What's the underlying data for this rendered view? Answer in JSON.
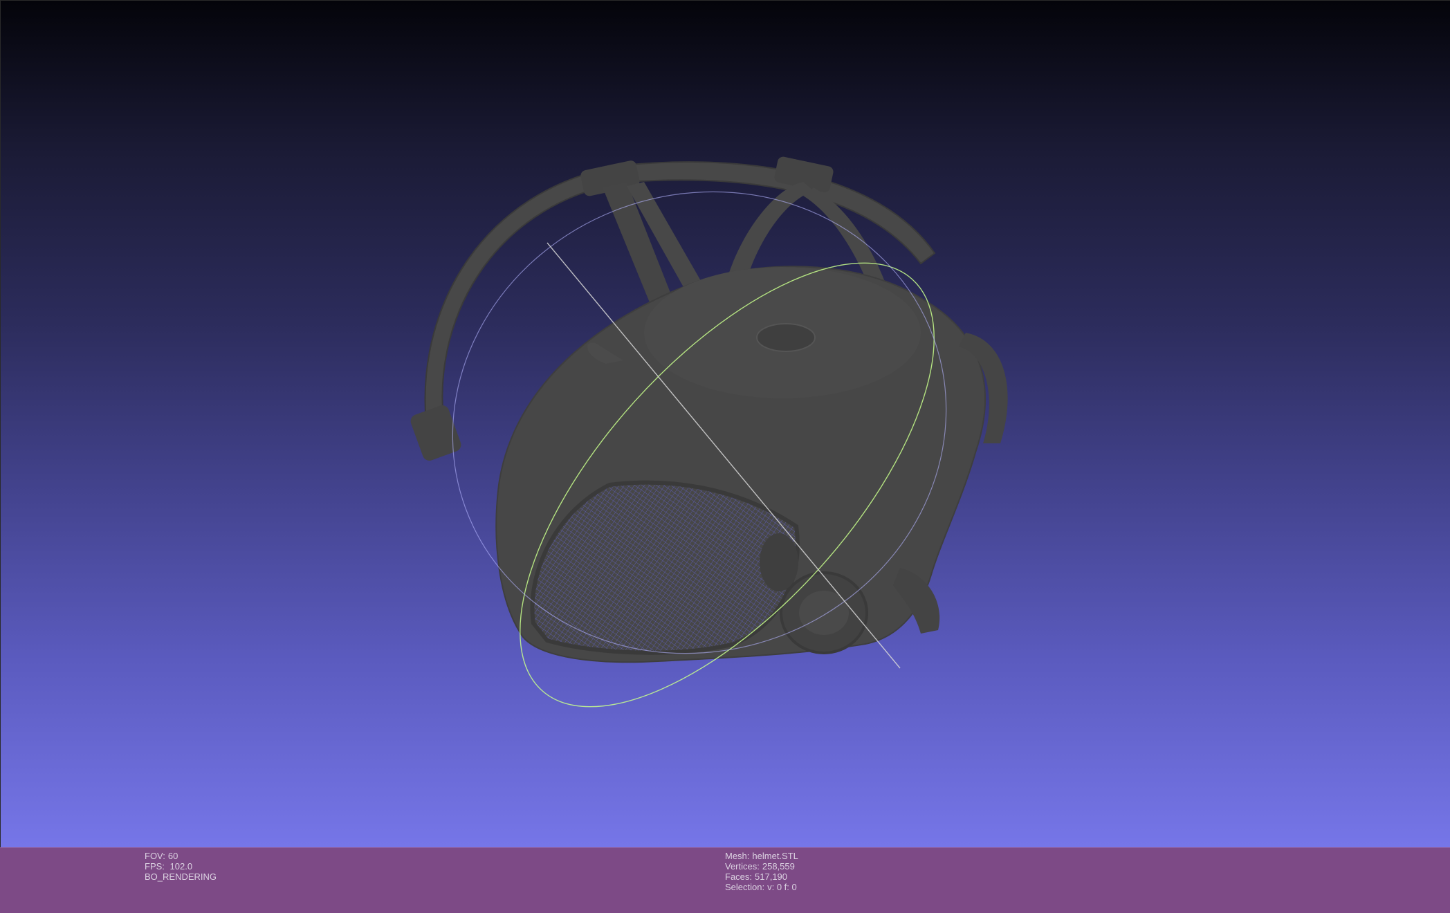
{
  "viewport": {
    "background_top": "#04040a",
    "background_bottom": "#7676e8",
    "mesh_color": "#454545",
    "trackball_colors": [
      "#c8c8c8",
      "#c8ff8c",
      "#b4b4ff"
    ]
  },
  "info_bar": {
    "background": "#7d4a86",
    "left": {
      "fov_label": "FOV:",
      "fov_value": "60",
      "fps_label": "FPS:",
      "fps_value": "102.0",
      "render_mode": "BO_RENDERING"
    },
    "right": {
      "mesh_label": "Mesh:",
      "mesh_value": "helmet.STL",
      "vertices_label": "Vertices:",
      "vertices_value": "258,559",
      "faces_label": "Faces:",
      "faces_value": "517,190",
      "selection_label": "Selection:",
      "selection_value": "v: 0 f: 0"
    }
  }
}
